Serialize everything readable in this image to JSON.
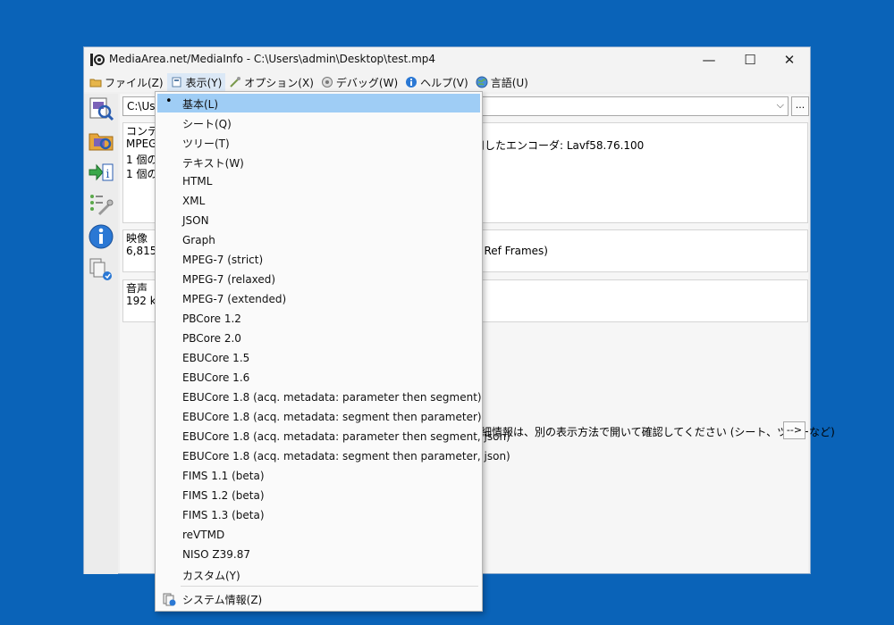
{
  "window": {
    "title": "MediaArea.net/MediaInfo - C:\\Users\\admin\\Desktop\\test.mp4",
    "controls": {
      "minimize": "—",
      "maximize": "☐",
      "close": "✕"
    }
  },
  "menubar": [
    {
      "label": "ファイル(Z)",
      "icon": "folder-icon"
    },
    {
      "label": "表示(Y)",
      "icon": "view-icon"
    },
    {
      "label": "オプション(X)",
      "icon": "options-icon"
    },
    {
      "label": "デバッグ(W)",
      "icon": "debug-icon"
    },
    {
      "label": "ヘルプ(V)",
      "icon": "help-icon"
    },
    {
      "label": "言語(U)",
      "icon": "globe-icon"
    }
  ],
  "toolbar": [
    "open-file-icon",
    "open-folder-icon",
    "export-info-icon",
    "options-icon",
    "about-icon",
    "knowledge-base-icon"
  ],
  "file_path": "C:\\Us",
  "browse_label": "...",
  "panels": {
    "general": {
      "header": "コンテ",
      "lines": [
        "MPEG",
        "1 個の",
        "1 個の"
      ],
      "right": "用したエンコーダ: Lavf58.76.100"
    },
    "video": {
      "header": "映像",
      "line": "6,815",
      "right": "4 Ref Frames)"
    },
    "audio": {
      "header": "音声",
      "line": "192 k"
    }
  },
  "note": "詳細情報は、別の表示方法で開いて確認してください (シート、ツリーなど)",
  "more_button": "-->",
  "view_menu": {
    "selected_index": 0,
    "bullet": "•",
    "items": [
      "基本(L)",
      "シート(Q)",
      "ツリー(T)",
      "テキスト(W)",
      "HTML",
      "XML",
      "JSON",
      "Graph",
      "MPEG-7 (strict)",
      "MPEG-7 (relaxed)",
      "MPEG-7 (extended)",
      "PBCore 1.2",
      "PBCore 2.0",
      "EBUCore 1.5",
      "EBUCore 1.6",
      "EBUCore 1.8 (acq. metadata: parameter then segment)",
      "EBUCore 1.8 (acq. metadata: segment then parameter)",
      "EBUCore 1.8 (acq. metadata: parameter then segment, json)",
      "EBUCore 1.8 (acq. metadata: segment then parameter, json)",
      "FIMS 1.1 (beta)",
      "FIMS 1.2 (beta)",
      "FIMS 1.3 (beta)",
      "reVTMD",
      "NISO Z39.87",
      "カスタム(Y)"
    ],
    "system_info": {
      "label": "システム情報(Z)",
      "icon": "system-info-icon"
    }
  }
}
